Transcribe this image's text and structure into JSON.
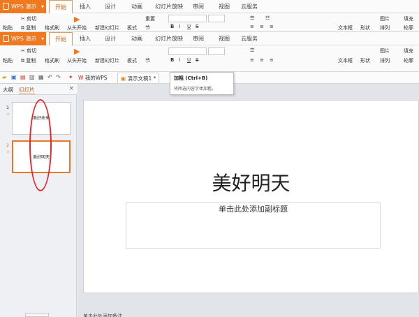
{
  "app": {
    "name": "WPS 演示",
    "accent": "#f0781e"
  },
  "menu_tabs": [
    "开始",
    "插入",
    "设计",
    "动画",
    "幻灯片放映",
    "审阅",
    "视图",
    "云服务"
  ],
  "ribbon": {
    "paste": "粘贴",
    "cut": "剪切",
    "copy": "复制",
    "format_painter": "格式刷",
    "from_start": "从头开始",
    "new_slide": "新建幻灯片",
    "layout": "板式",
    "reset": "重置",
    "section": "节",
    "bold": "B",
    "italic": "I",
    "underline": "U",
    "strike": "S",
    "text_box": "文本框",
    "shape": "形状",
    "picture": "图片",
    "arrange": "排列",
    "fill": "填充",
    "outline": "轮廓"
  },
  "quick_access": {
    "doc_tabs": [
      {
        "label": "我的WPS",
        "active": false
      },
      {
        "label": "演示文稿1 *",
        "active": true
      }
    ]
  },
  "tooltip": {
    "title": "加粗 (Ctrl+B)",
    "desc": "将所选内容字体加粗。"
  },
  "left_pane": {
    "tabs": [
      "大纲",
      "幻灯片"
    ],
    "close": "×",
    "slides": [
      {
        "num": "1",
        "title": "美好未来",
        "selected": false
      },
      {
        "num": "2",
        "title": "美好明天",
        "selected": true
      }
    ]
  },
  "slide": {
    "title": "美好明天",
    "subtitle_placeholder": "单击此处添加副标题"
  },
  "notes_placeholder": "单击此处添加备注",
  "annotation": {
    "color": "#e5262e",
    "shape": "ellipse"
  }
}
